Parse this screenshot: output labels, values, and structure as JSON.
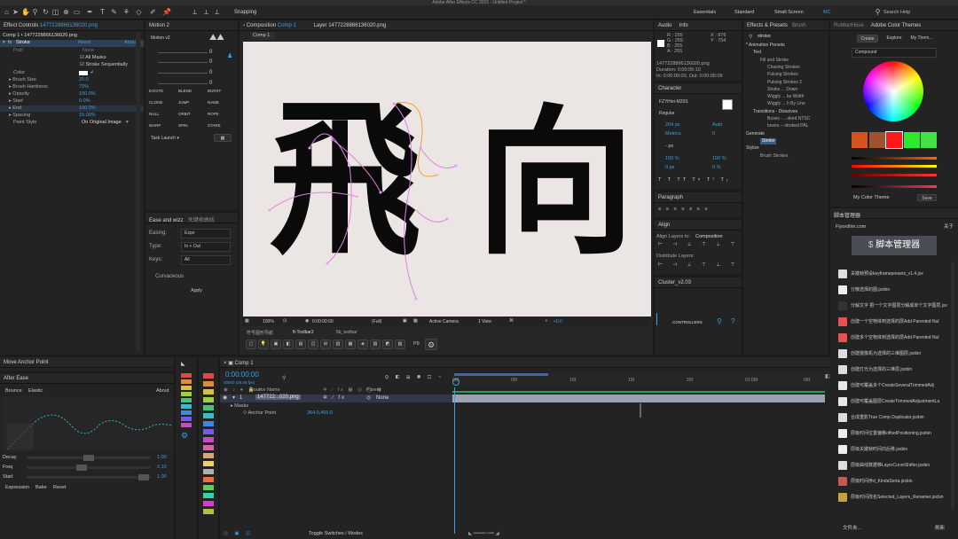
{
  "app": {
    "title": "Adobe After Effects CC 2015 - Untitled Project *"
  },
  "toolbar": {
    "snapping": "Snapping",
    "workspaces": [
      "Essentials",
      "Standard",
      "Small Screen"
    ],
    "mc": "MC",
    "search_placeholder": "Search Help"
  },
  "effect_controls": {
    "tab": "Effect Controls",
    "file": "1477228866136020.png",
    "subtitle": "Comp 1 • 1477228866136020.png",
    "effect_name": "Stroke",
    "reset": "Reset",
    "about": "About",
    "path_label": "Path",
    "path_value": "None",
    "all_masks": "All Masks",
    "sequential": "Stroke Sequentially",
    "params": [
      {
        "label": "Color",
        "value": ""
      },
      {
        "label": "Brush Size",
        "value": "20.0"
      },
      {
        "label": "Brush Hardness",
        "value": "79%"
      },
      {
        "label": "Opacity",
        "value": "100.0%"
      },
      {
        "label": "Start",
        "value": "0.0%"
      },
      {
        "label": "End",
        "value": "100.0%"
      },
      {
        "label": "Spacing",
        "value": "15.00%"
      },
      {
        "label": "Paint Style",
        "value": "On Original Image"
      }
    ]
  },
  "motion": {
    "title": "Motion 2",
    "dropdown": "Motion v2",
    "values": [
      "0",
      "0",
      "0",
      "0"
    ],
    "buttons": [
      "EXCITE",
      "BLEND",
      "BURST",
      "CLONE",
      "JUMP",
      "NAME",
      "NULL",
      "ORBIT",
      "ROPE",
      "WARP",
      "SPIN",
      "STARE"
    ],
    "task": "Task Launch"
  },
  "ease_panel": {
    "title": "Ease and wizz",
    "tab2": "关键帧曲线",
    "easing_label": "Easing:",
    "easing_value": "Expo",
    "type_label": "Type:",
    "type_value": "In + Out",
    "keys_label": "Keys:",
    "keys_value": "All",
    "curvaceous": "Curvaceous",
    "apply": "Apply"
  },
  "composition": {
    "tab": "Composition",
    "comp_name": "Comp 1",
    "layer_tab": "Layer 1477228866136020.png",
    "sub_tab": "Comp 1",
    "char1": "飛",
    "char2": "向",
    "zoom": "100%",
    "time": "0:00:00:00",
    "quality": "(Full)",
    "camera": "Active Camera",
    "view": "1 View",
    "offset": "+0.0"
  },
  "toolbar2": {
    "tabs": [
      "符号图形导航",
      "ft-Toolbar2",
      "5b_toolbar"
    ],
    "p9": "P9"
  },
  "info": {
    "tabs": [
      "Audio",
      "Info"
    ],
    "r": "R : 255",
    "g": "G : 255",
    "b": "B : 255",
    "a": "A : 255",
    "x": "X : 876",
    "y": "Y : 754",
    "file": "1477228866136020.png",
    "duration": "Duration: 0:00:05:10",
    "in_out": "In: 0:00:00:00, Out: 0:00:05:09"
  },
  "character": {
    "title": "Character",
    "font": "FZYiHei-M20S",
    "style": "Regular",
    "size": "204 px",
    "leading": "Auto",
    "kerning": "Metrics",
    "tracking": "0",
    "stroke": "- px",
    "vscale": "100 %",
    "hscale": "100 %",
    "baseline": "0 px",
    "tsume": "0 %"
  },
  "paragraph": {
    "title": "Paragraph"
  },
  "align": {
    "title": "Align",
    "align_to_label": "Align Layers to:",
    "align_to_value": "Composition",
    "distribute": "Distribute Layers:"
  },
  "cluster": {
    "title": "Cluster_v2.03",
    "controllers": "CONTROLLERS"
  },
  "effects_presets": {
    "tabs": [
      "Effects & Presets",
      "Brush"
    ],
    "search": "stroke",
    "tree": [
      {
        "text": "* Animation Presets",
        "level": 0
      },
      {
        "text": "Text",
        "level": 1
      },
      {
        "text": "Fill and Stroke",
        "level": 2
      },
      {
        "text": "Chasing Strokes",
        "level": 3
      },
      {
        "text": "Pulsing Strokes",
        "level": 3
      },
      {
        "text": "Pulsing Strokes 2",
        "level": 3
      },
      {
        "text": "Stroke ... Down",
        "level": 3
      },
      {
        "text": "Wiggly ... ke Width",
        "level": 3
      },
      {
        "text": "Wiggly ... h By Line",
        "level": 3
      },
      {
        "text": "Transitions - Dissolves",
        "level": 1
      },
      {
        "text": "Boxes - ...oked NTSC",
        "level": 3
      },
      {
        "text": "boxes -- stroked PAL",
        "level": 3
      },
      {
        "text": "Generate",
        "level": 0
      },
      {
        "text": "Stroke",
        "level": 2,
        "selected": true
      },
      {
        "text": "Stylize",
        "level": 0
      },
      {
        "text": "Brush Strokes",
        "level": 2
      }
    ]
  },
  "color_themes": {
    "tabs": [
      "RubberHose",
      "Adobe Color Themes"
    ],
    "buttons": [
      "Create",
      "Explore",
      "My Them..."
    ],
    "rule": "Compound",
    "swatches": [
      "#d4541b",
      "#a0522d",
      "#ff1a1a",
      "#2ee82e",
      "#45e045"
    ],
    "my_theme": "My Color Theme",
    "save": "Save"
  },
  "script_library": {
    "title": "脚本管理器",
    "site": "Flyordlim.com",
    "link": "关于",
    "banner": "脚本管理器",
    "items": [
      "关键帧预设keyframepresets_v1.4.jsx",
      "分散选择的图.jsxbin",
      "分解文字 把一个文字图层分解成单个文字图层.jsx",
      "创建一个空物体到选择的层Add Parented Nul",
      "创建多个空物体到选择的层Add Parented Nul",
      "创建摄像机为选择的三维图层.jsxbin",
      "创建灯光为选择的三维层.jsxbin",
      "创建可覆盖多个CreateSeveralTrimmedAdj",
      "创建可覆盖图层CreateTrimmedAdjustmentLa",
      "合成重影True Comp Duplicator.jsxbin",
      "层级时间位置偏移offsetPositioning.jsxbin",
      "层级关键帧时间向后移.jsxbin",
      "层级曲线数据移LayerCurveShifter.jsxbin",
      "层级时间序d_KindaSorta.jsxbin",
      "层级时间改名Selected_Layers_Renamer.jsxbin"
    ],
    "footer_left": "文件夹...",
    "footer_right": "刷新"
  },
  "anchor": {
    "title": "Move Anchor Point"
  },
  "after_ease": {
    "title": "After Ease",
    "tabs": [
      "Bounce",
      "Elastic"
    ],
    "about": "About",
    "decay_label": "Decay",
    "decay_value": "1.00",
    "freq_label": "Freq",
    "freq_value": "0.10",
    "start_label": "Start",
    "start_value": "1.00",
    "buttons": [
      "Expression",
      "Bake",
      "Reset"
    ]
  },
  "palette": {
    "colors": [
      "#e04848",
      "#e08a3a",
      "#d8c03a",
      "#9dd04a",
      "#4ac07a",
      "#3abccf",
      "#3a8ae0",
      "#7a5ae0",
      "#c050c0",
      "#e060a0",
      "#dda37a",
      "#e8d07a",
      "#b0b0b0",
      "#e8703a",
      "#5ad05a",
      "#3acfb0",
      "#d040d0",
      "#b0c040"
    ]
  },
  "timeline": {
    "comp_tab": "Comp 1",
    "timecode": "0:00:00:00",
    "fps": "00000 (25.00 fps)",
    "search_placeholder": "",
    "col_source": "Source Name",
    "col_parent": "Parent",
    "layer_num": "1",
    "layer_name": "147722...020.png",
    "parent_value": "None",
    "masks": "Masks",
    "anchor_label": "Anchor Point",
    "anchor_value": "364.0,465.0",
    "ruler": [
      "00f",
      "05f",
      "10f",
      "15f",
      "20f",
      "01:00f",
      "05f"
    ],
    "toggle": "Toggle Switches / Modes"
  }
}
